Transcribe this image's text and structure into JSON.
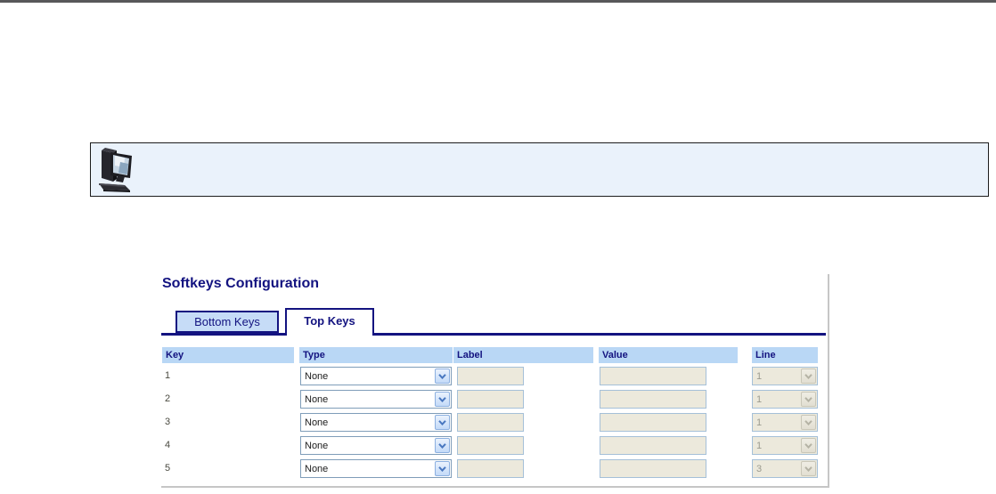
{
  "window": {
    "top_rule": true
  },
  "note": {
    "icon": "computer-monitor-icon",
    "text": ""
  },
  "softkeys": {
    "heading": "Softkeys Configuration",
    "tabs": [
      {
        "label": "Bottom Keys",
        "active": false
      },
      {
        "label": "Top Keys",
        "active": true
      }
    ],
    "columns": [
      "Key",
      "Type",
      "Label",
      "Value",
      "Line"
    ],
    "rows": [
      {
        "key": "1",
        "type": "None",
        "label": "",
        "value": "",
        "line": "1"
      },
      {
        "key": "2",
        "type": "None",
        "label": "",
        "value": "",
        "line": "1"
      },
      {
        "key": "3",
        "type": "None",
        "label": "",
        "value": "",
        "line": "1"
      },
      {
        "key": "4",
        "type": "None",
        "label": "",
        "value": "",
        "line": "1"
      },
      {
        "key": "5",
        "type": "None",
        "label": "",
        "value": "",
        "line": "3"
      }
    ],
    "controls_state": {
      "type_enabled": true,
      "label_enabled": false,
      "value_enabled": false,
      "line_enabled": false
    }
  },
  "colors": {
    "topbar": "#58585a",
    "navy": "#131380",
    "header_bg": "#b9d7f5",
    "tab_bg": "#c6dcf7",
    "note_bg": "#eaf2fb",
    "note_border": "#1c1c1c",
    "disabled_bg": "#ece9dc",
    "disabled_border": "#a5c0d8",
    "enabled_border": "#7f9db9",
    "disabled_text": "#9b9b8f",
    "key_text": "#4a4a40",
    "panel_border": "#c6c6c6",
    "arrow_color": "#4a78c0",
    "arrow_disabled": "#b5b3a5"
  }
}
